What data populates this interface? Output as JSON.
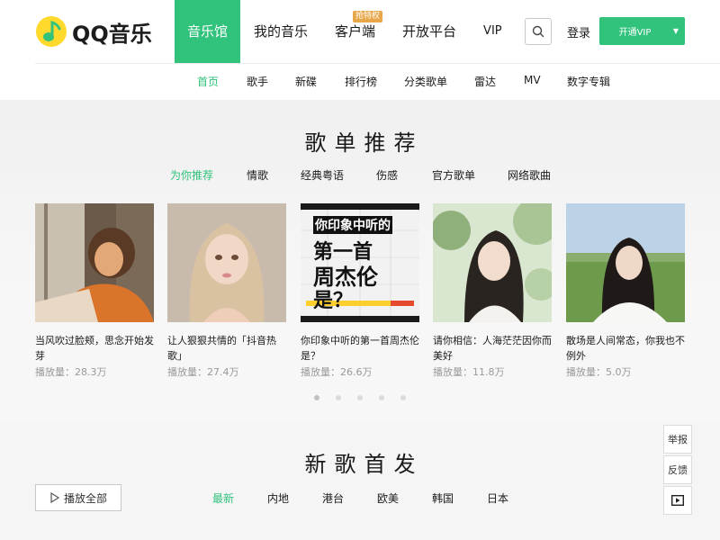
{
  "brand": {
    "name": "QQ音乐",
    "accent": "#31c27c"
  },
  "header": {
    "nav": [
      {
        "label": "音乐馆",
        "active": true
      },
      {
        "label": "我的音乐"
      },
      {
        "label": "客户端",
        "badge": "抢特权"
      },
      {
        "label": "开放平台"
      },
      {
        "label": "VIP"
      }
    ],
    "search_icon": "search-icon",
    "login": "登录",
    "vip_button": "开通VIP",
    "vip_button_icon": "caret-down-icon"
  },
  "subnav": [
    "首页",
    "歌手",
    "新碟",
    "排行榜",
    "分类歌单",
    "雷达",
    "MV",
    "数字专辑"
  ],
  "playlists": {
    "title": "歌单推荐",
    "tabs": [
      "为你推荐",
      "情歌",
      "经典粤语",
      "伤感",
      "官方歌单",
      "网络歌曲"
    ],
    "items": [
      {
        "name": "当风吹过脸颊，思念开始发芽",
        "plays": "播放量：28.3万"
      },
      {
        "name": "让人狠狠共情的「抖音热歌」",
        "plays": "播放量：27.4万"
      },
      {
        "name": "你印象中听的第一首周杰伦是？",
        "plays": "播放量：26.6万",
        "cover_text": [
          "你印象中听的",
          "第一首",
          "周杰伦",
          "是？"
        ]
      },
      {
        "name": "请你相信：人海茫茫因你而美好",
        "plays": "播放量：11.8万"
      },
      {
        "name": "散场是人间常态，你我也不例外",
        "plays": "播放量：5.0万"
      }
    ],
    "pages": 5,
    "current_page": 1
  },
  "new_songs": {
    "title": "新歌首发",
    "play_all": "播放全部",
    "tabs": [
      "最新",
      "内地",
      "港台",
      "欧美",
      "韩国",
      "日本"
    ]
  },
  "side_tools": [
    "举报",
    "反馈"
  ]
}
